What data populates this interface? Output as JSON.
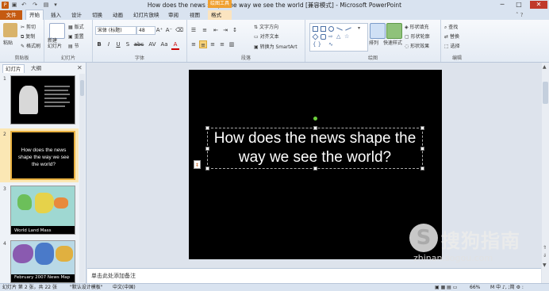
{
  "window": {
    "title": "How does the news shape the way we see the world [兼容模式] - Microsoft PowerPoint",
    "context_group": "绘图工具",
    "controls": [
      "─",
      "□",
      "✕"
    ]
  },
  "tabs": [
    {
      "label": "文件"
    },
    {
      "label": "开始"
    },
    {
      "label": "插入"
    },
    {
      "label": "设计"
    },
    {
      "label": "切换"
    },
    {
      "label": "动画"
    },
    {
      "label": "幻灯片放映"
    },
    {
      "label": "审阅"
    },
    {
      "label": "视图"
    },
    {
      "label": "格式"
    }
  ],
  "ribbon": {
    "clipboard": {
      "paste": "粘贴",
      "cut": "剪切",
      "copy": "复制",
      "format_painter": "格式刷",
      "label": "剪贴板"
    },
    "slides": {
      "new_slide": "新建\n幻灯片",
      "layout": "版式",
      "reset": "重置",
      "section": "节",
      "label": "幻灯片"
    },
    "font": {
      "font_name": "宋体 (标题)",
      "font_size": "48",
      "bold": "B",
      "italic": "I",
      "underline": "U",
      "shadow": "S",
      "strike": "abc",
      "spacing": "AV",
      "case": "Aa",
      "label": "字体"
    },
    "paragraph": {
      "text_direction": "文字方向",
      "align_text": "对齐文本",
      "smartart": "转换为 SmartArt",
      "label": "段落"
    },
    "drawing": {
      "arrange": "排列",
      "quick_styles": "快速样式",
      "shape_fill": "形状填充",
      "shape_outline": "形状轮廓",
      "shape_effects": "形状效果",
      "label": "绘图"
    },
    "editing": {
      "find": "查找",
      "replace": "替换",
      "select": "选择",
      "label": "编辑"
    }
  },
  "left_pane": {
    "tabs": [
      "幻灯片",
      "大纲"
    ],
    "slides": [
      {
        "number": "1",
        "caption": ""
      },
      {
        "number": "2",
        "caption": "How does the news shape the way we see the world?"
      },
      {
        "number": "3",
        "caption": "World Land Mass"
      },
      {
        "number": "4",
        "caption": "February 2007 News Map"
      }
    ]
  },
  "slide": {
    "text": "How does the news shape the way we see the world?"
  },
  "notes": {
    "placeholder": "单击此处添加备注"
  },
  "status": {
    "slide_info": "幻灯片 第 2 张，共 22 张",
    "theme": "\"默认设计模板\"",
    "language": "中文(中国)",
    "zoom": "66%",
    "ime": "M 中 ♪, ;简 ⚙ :"
  },
  "watermark": {
    "logo": "S",
    "brand": "搜狗指南",
    "url": "zhinan.sogou.com"
  },
  "colors": {
    "file_tab": "#c55a11",
    "context_tab": "#f0a030",
    "slide_bg": "#000000",
    "close_btn": "#c0392b"
  }
}
